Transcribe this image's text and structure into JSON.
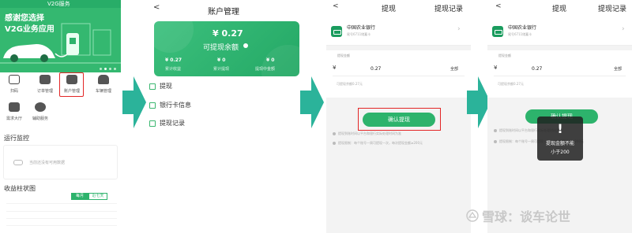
{
  "colors": {
    "accent": "#2db36c",
    "highlight": "#e32626",
    "arrow": "#2bb39a"
  },
  "screen1": {
    "title": "V2G服务",
    "banner": {
      "line1": "感谢您选择",
      "line2": "V2G业务应用"
    },
    "grid": [
      {
        "icon": "scan-icon",
        "label": "扫码"
      },
      {
        "icon": "order-icon",
        "label": "订单管理"
      },
      {
        "icon": "wallet-icon",
        "label": "账户管理"
      },
      {
        "icon": "car-icon",
        "label": "车辆管理"
      },
      {
        "icon": "demand-icon",
        "label": "需求大厅"
      },
      {
        "icon": "help-icon",
        "label": "辅助服务"
      }
    ],
    "monitor_title": "运行监控",
    "monitor_empty": "当前还没有可用数据",
    "chart_title": "收益柱状图",
    "tabs": [
      "每月",
      "近七天"
    ]
  },
  "screen2": {
    "back": "<",
    "title": "账户管理",
    "amount": "¥ 0.27",
    "amount_label": "可提现余额",
    "stats": [
      {
        "value": "¥ 0.27",
        "label": "累计收益"
      },
      {
        "value": "¥ 0",
        "label": "累计提现"
      },
      {
        "value": "¥ 0",
        "label": "提现中金额"
      }
    ],
    "menu": [
      "提现",
      "银行卡信息",
      "提现记录"
    ]
  },
  "screen3": {
    "back": "<",
    "title": "提现",
    "right_link": "提现记录",
    "bank_name": "中国农业银行",
    "bank_sub": "尾号6711储蓄卡",
    "amount_label": "提现金额",
    "currency": "¥",
    "amount_value": "0.27",
    "all_label": "全部",
    "available": "可提现余额0.27元",
    "confirm": "确认提现",
    "notes": [
      "提现到账时间以平台和银行实际处理时间为准",
      "提现限制：每个账号一周可提现一次，每次提现金额≥200元"
    ]
  },
  "screen4": {
    "back": "<",
    "title": "提现",
    "right_link": "提现记录",
    "bank_name": "中国农业银行",
    "bank_sub": "尾号6711储蓄卡",
    "amount_label": "提现金额",
    "currency": "¥",
    "amount_value": "0.27",
    "all_label": "全部",
    "available": "可提现余额0.27元",
    "confirm": "确认提现",
    "toast_icon": "!",
    "toast_line1": "提现金额不能",
    "toast_line2": "小于200",
    "notes": [
      "提现到账时间以平台和银行实际处理时间为准",
      "提现限制：每个账号一周可提现一次，每次提现金额≥200元"
    ]
  },
  "watermark": "雪球：谈车论世"
}
